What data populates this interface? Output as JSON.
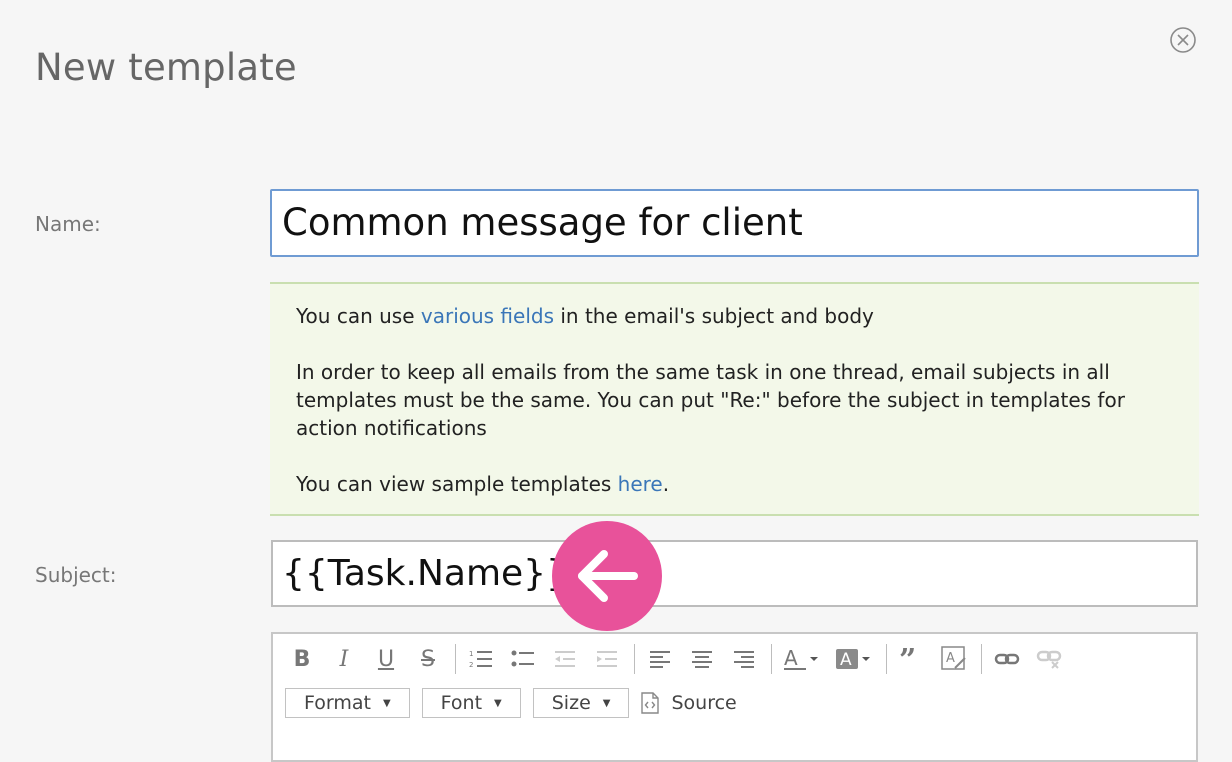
{
  "header": {
    "title": "New template"
  },
  "form": {
    "name_label": "Name:",
    "name_value": "Common message for client",
    "subject_label": "Subject:",
    "subject_value": "{{Task.Name}}"
  },
  "info": {
    "line1_pre": "You can use ",
    "line1_link": "various fields",
    "line1_post": " in the email's subject and body",
    "line2": "In order to keep all emails from the same task in one thread, email subjects in all templates must be the same. You can put \"Re:\" before the subject in templates for action notifications",
    "line3_pre": "You can view sample templates ",
    "line3_link": "here",
    "line3_post": "."
  },
  "toolbar": {
    "bold": "B",
    "italic": "I",
    "underline": "U",
    "strike": "S",
    "format": "Format",
    "font": "Font",
    "size": "Size",
    "source": "Source"
  },
  "colors": {
    "accent": "#e8529a",
    "link": "#3a76b8",
    "info_bg": "#f3f8e9",
    "focus_border": "#6f9bd3"
  }
}
